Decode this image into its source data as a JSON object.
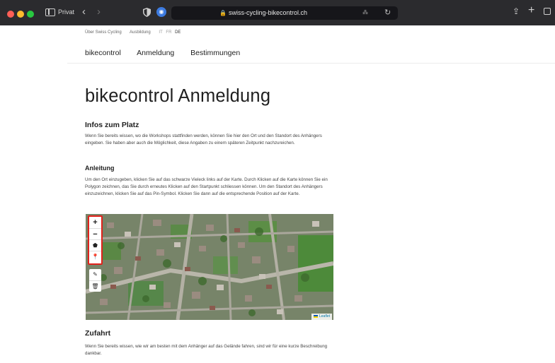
{
  "browser": {
    "mode_label": "Privat",
    "url": "swiss-cycling-bikecontrol.ch"
  },
  "topbar": {
    "links": [
      "Über Swiss Cycling",
      "Ausbildung"
    ],
    "languages": [
      "IT",
      "FR",
      "DE"
    ],
    "active_language": "DE"
  },
  "mainnav": {
    "items": [
      "bikecontrol",
      "Anmeldung",
      "Bestimmungen"
    ]
  },
  "page": {
    "title": "bikecontrol Anmeldung",
    "section1_heading": "Infos zum Platz",
    "section1_text": "Wenn Sie bereits wissen, wo die Workshops stattfinden werden, können Sie hier den Ort und den Standort des Anhängers eingeben. Sie haben aber auch die Möglichkeit, diese Angaben zu einem späteren Zeitpunkt nachzureichen.",
    "section2_heading": "Anleitung",
    "section2_text": "Um den Ort einzugeben, klicken Sie auf das schwarze Vieleck links auf der Karte. Durch Klicken auf die Karte können Sie ein Polygon zeichnen, das Sie durch erneutes Klicken auf den Startpunkt schliessen können. Um den Standort des Anhängers einzuzeichnen, klicken Sie auf das Pin-Symbol. Klicken Sie dann auf die entsprechende Position auf der Karte.",
    "section3_heading": "Zufahrt",
    "section3_text": "Wenn Sie bereits wissen, wie wir am besten mit dem Anhänger auf das Gelände fahren, sind wir für eine kurze Beschreibung dankbar."
  },
  "map": {
    "zoom_in_label": "+",
    "zoom_out_label": "−",
    "attribution": "Leaflet",
    "control_icons": [
      "polygon-icon",
      "pin-icon",
      "edit-icon",
      "trash-icon"
    ]
  }
}
